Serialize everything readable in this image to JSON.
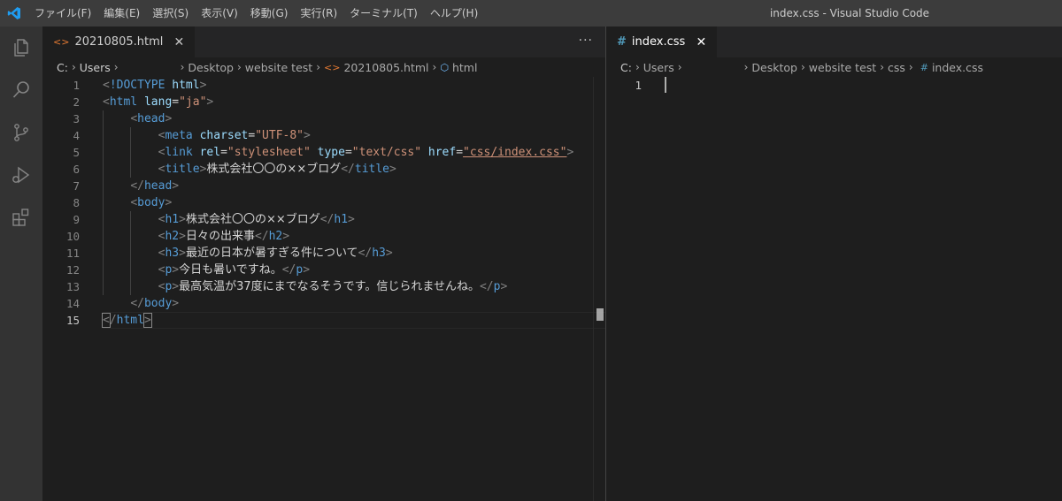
{
  "titlebar": {
    "menu": [
      "ファイル(F)",
      "編集(E)",
      "選択(S)",
      "表示(V)",
      "移動(G)",
      "実行(R)",
      "ターミナル(T)",
      "ヘルプ(H)"
    ],
    "window_title": "index.css - Visual Studio Code"
  },
  "left": {
    "tab": {
      "label": "20210805.html",
      "close": "✕",
      "icon": "<>"
    },
    "more_actions": "···",
    "breadcrumb": [
      "C:",
      "Users",
      "Desktop",
      "website test",
      "20210805.html",
      "html"
    ],
    "lines": [
      {
        "n": "1"
      },
      {
        "n": "2"
      },
      {
        "n": "3"
      },
      {
        "n": "4"
      },
      {
        "n": "5"
      },
      {
        "n": "6"
      },
      {
        "n": "7"
      },
      {
        "n": "8"
      },
      {
        "n": "9"
      },
      {
        "n": "10"
      },
      {
        "n": "11"
      },
      {
        "n": "12"
      },
      {
        "n": "13"
      },
      {
        "n": "14"
      },
      {
        "n": "15"
      }
    ],
    "code": {
      "doctype": "!DOCTYPE",
      "html": "html",
      "lang_attr": "lang",
      "lang_val": "\"ja\"",
      "head": "head",
      "meta": "meta",
      "charset_attr": "charset",
      "charset_val": "\"UTF-8\"",
      "link": "link",
      "rel_attr": "rel",
      "rel_val": "\"stylesheet\"",
      "type_attr": "type",
      "type_val": "\"text/css\"",
      "href_attr": "href",
      "href_val": "\"css/index.css\"",
      "title": "title",
      "title_text": "株式会社〇〇の××ブログ",
      "body": "body",
      "h1": "h1",
      "h1_text": "株式会社〇〇の××ブログ",
      "h2": "h2",
      "h2_text": "日々の出来事",
      "h3": "h3",
      "h3_text": "最近の日本が暑すぎる件について",
      "p": "p",
      "p1_text": "今日も暑いですね。",
      "p2_text": "最高気温が37度にまでなるそうです。信じられませんね。"
    }
  },
  "right": {
    "tab": {
      "label": "index.css",
      "close": "✕",
      "icon": "#"
    },
    "breadcrumb": [
      "C:",
      "Users",
      "Desktop",
      "website test",
      "css",
      "index.css"
    ],
    "line_numbers": [
      "1"
    ]
  },
  "colors": {
    "tag": "#569cd6",
    "attr": "#9cdcfe",
    "string": "#ce9178",
    "bracket": "#808080"
  }
}
